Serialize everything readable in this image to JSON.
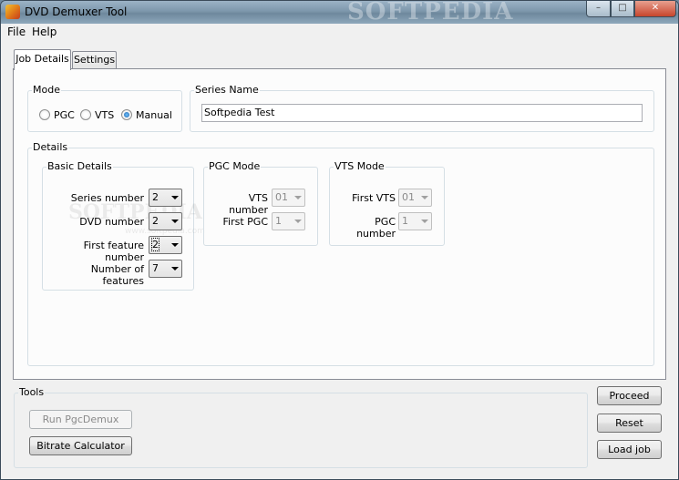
{
  "window": {
    "title": "DVD Demuxer Tool",
    "title_watermark": "SOFTPEDIA",
    "controls": {
      "minimize": "–",
      "maximize": "□",
      "close": "✕"
    }
  },
  "menu": {
    "file": "File",
    "help": "Help"
  },
  "tabs": {
    "job_details": "Job Details",
    "settings": "Settings",
    "active": "Job Details"
  },
  "mode": {
    "title": "Mode",
    "options": [
      "PGC",
      "VTS",
      "Manual"
    ],
    "selected": "Manual"
  },
  "series": {
    "title": "Series Name",
    "value": "Softpedia Test"
  },
  "details": {
    "title": "Details",
    "watermark": "SOFTPEDIA",
    "watermark_url": "www.softpedia.com",
    "basic": {
      "title": "Basic Details",
      "series_number": {
        "label": "Series number",
        "value": "2"
      },
      "dvd_number": {
        "label": "DVD number",
        "value": "2"
      },
      "first_feature_number": {
        "label": "First feature number",
        "value": "2"
      },
      "number_of_features": {
        "label": "Number of features",
        "value": "7"
      }
    },
    "pgc_mode": {
      "title": "PGC Mode",
      "vts_number": {
        "label": "VTS number",
        "value": "01"
      },
      "first_pgc": {
        "label": "First PGC",
        "value": "1"
      }
    },
    "vts_mode": {
      "title": "VTS Mode",
      "first_vts": {
        "label": "First VTS",
        "value": "01"
      },
      "pgc_number": {
        "label": "PGC number",
        "value": "1"
      }
    }
  },
  "tools": {
    "title": "Tools",
    "run_pgcdemux": "Run PgcDemux",
    "bitrate_calculator": "Bitrate Calculator"
  },
  "actions": {
    "proceed": "Proceed",
    "reset": "Reset",
    "load_job": "Load job"
  },
  "colors": {
    "radio_selected": "#1d5fa8",
    "disabled_text": "#8a8a8a"
  }
}
